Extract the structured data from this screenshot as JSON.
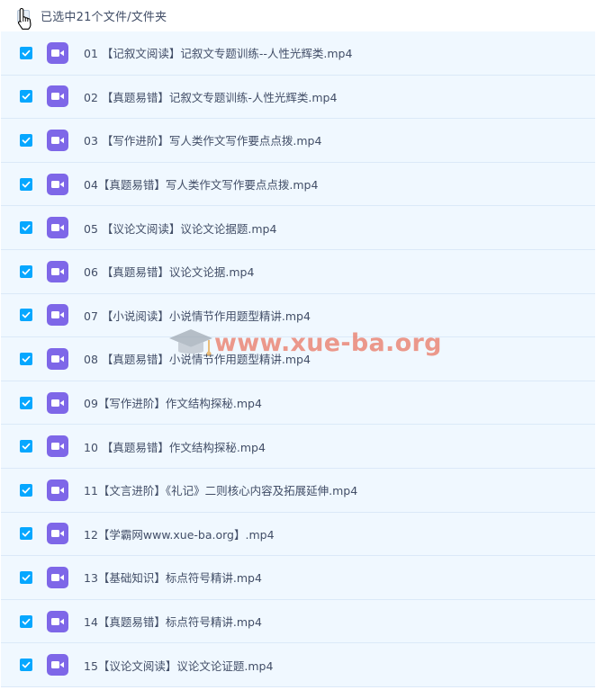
{
  "header": {
    "selection_text": "已选中21个文件/文件夹"
  },
  "files": [
    {
      "name": "01 【记叙文阅读】记叙文专题训练--人性光辉类.mp4"
    },
    {
      "name": "02 【真题易错】记叙文专题训练-人性光辉类.mp4"
    },
    {
      "name": "03 【写作进阶】写人类作文写作要点点拨.mp4"
    },
    {
      "name": "04【真题易错】写人类作文写作要点点拨.mp4"
    },
    {
      "name": "05 【议论文阅读】议论文论据题.mp4"
    },
    {
      "name": "06 【真题易错】议论文论据.mp4"
    },
    {
      "name": "07 【小说阅读】小说情节作用题型精讲.mp4"
    },
    {
      "name": "08 【真题易错】小说情节作用题型精讲.mp4"
    },
    {
      "name": "09【写作进阶】作文结构探秘.mp4"
    },
    {
      "name": "10 【真题易错】作文结构探秘.mp4"
    },
    {
      "name": "11【文言进阶】《礼记》二则核心内容及拓展延伸.mp4"
    },
    {
      "name": "12【学霸网www.xue-ba.org】.mp4"
    },
    {
      "name": "13【基础知识】标点符号精讲.mp4"
    },
    {
      "name": "14【真题易错】标点符号精讲.mp4"
    },
    {
      "name": "15【议论文阅读】议论文论证题.mp4"
    }
  ],
  "watermark": {
    "text": "www.xue-ba.org"
  },
  "colors": {
    "checkbox": "#06a7ff",
    "video_icon": "#7e67e8",
    "row_bg": "#f0f8ff",
    "text": "#424e67",
    "watermark": "#e9705c"
  },
  "icons": {
    "file_type": "video-file-icon",
    "checkbox": "checkbox-checked-icon",
    "cursor": "hand-pointer-cursor-icon",
    "watermark_logo": "graduation-cap-icon"
  }
}
